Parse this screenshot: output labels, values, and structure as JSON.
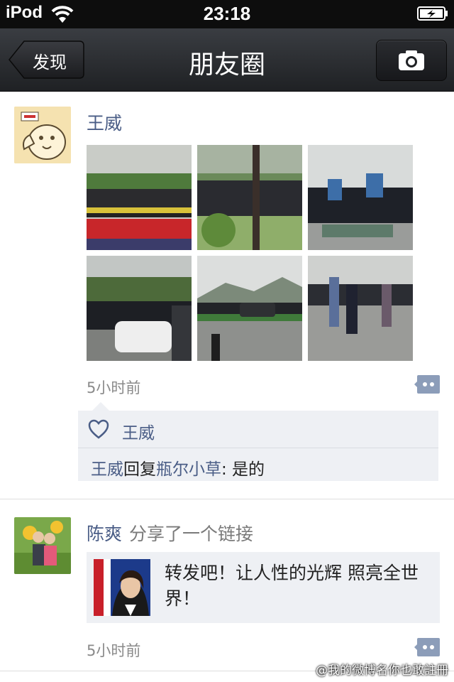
{
  "status_bar": {
    "carrier": "iPod",
    "time": "23:18"
  },
  "navbar": {
    "back_label": "发现",
    "title": "朋友圈"
  },
  "posts": [
    {
      "author": "王威",
      "time": "5小时前",
      "likes": [
        "王威"
      ],
      "comment": {
        "from": "王威",
        "verb": "回复",
        "to": "瓶尔小草",
        "text": ": 是的"
      }
    },
    {
      "author": "陈爽",
      "action": "分享了一个链接",
      "link_text": "转发吧！让人性的光辉 照亮全世界！",
      "time": "5小时前"
    }
  ],
  "watermark": "@我的微博名你也敢註冊",
  "colors": {
    "link_blue": "#4a5d86",
    "navbar": "#2c2e32",
    "comment_icon": "#8c9db9"
  }
}
